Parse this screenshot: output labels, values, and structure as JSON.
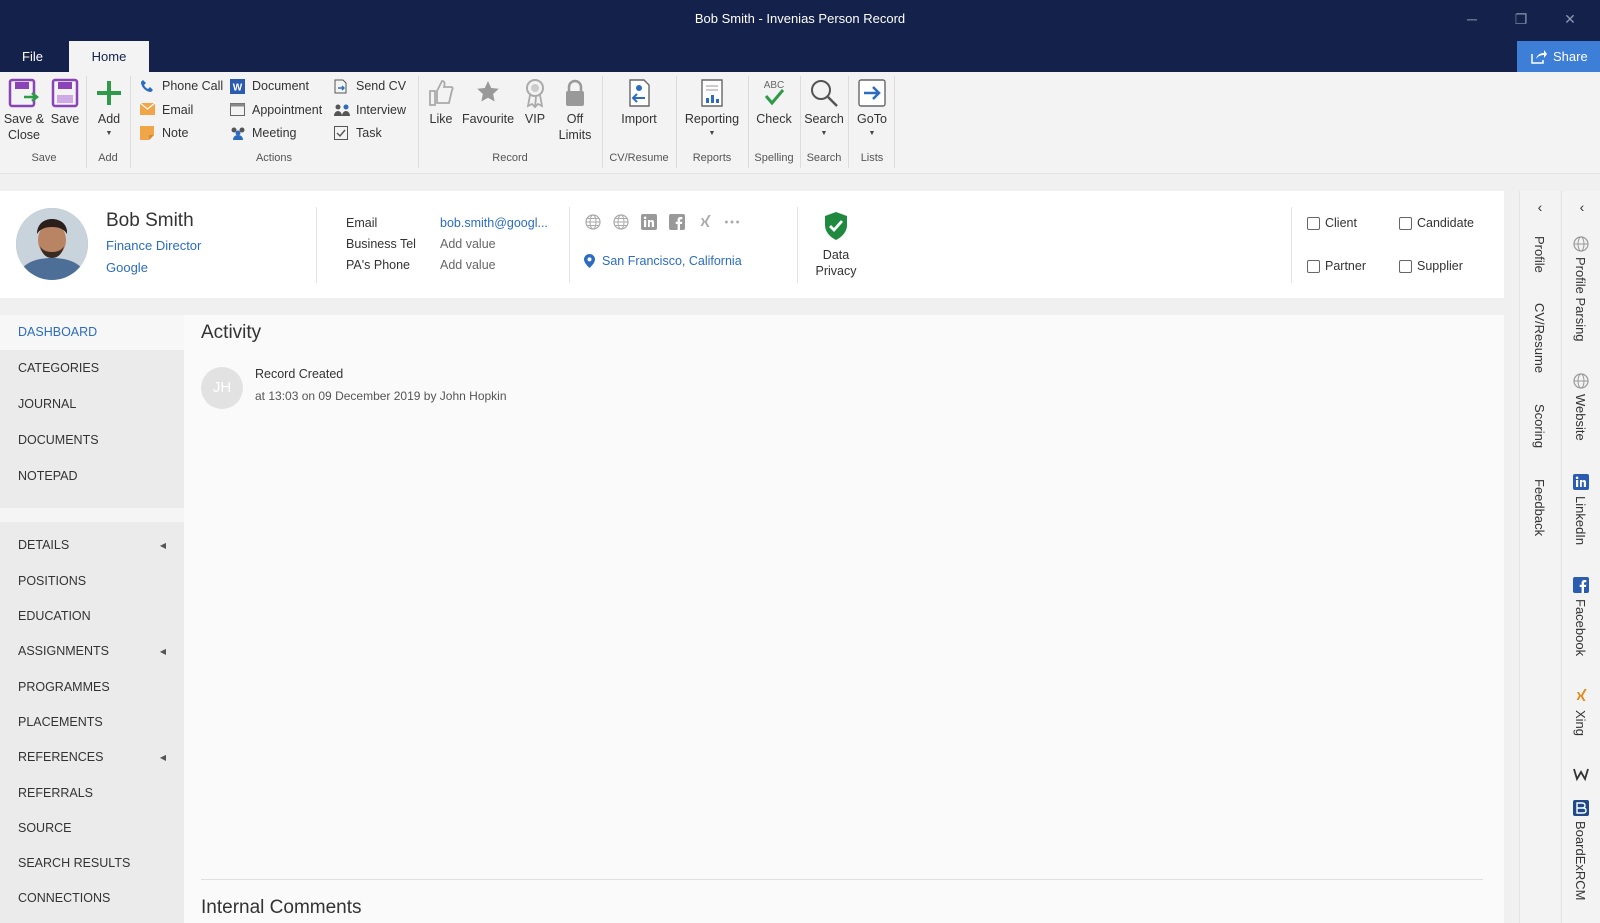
{
  "window": {
    "title": "Bob Smith - Invenias Person Record",
    "tabs": {
      "file": "File",
      "home": "Home"
    },
    "share": "Share",
    "controls": {
      "minimize": "─",
      "restore": "❐",
      "close": "✕"
    }
  },
  "ribbon": {
    "save_close": [
      "Save &",
      "Close"
    ],
    "save": "Save",
    "add": "Add",
    "actions": {
      "phone_call": "Phone Call",
      "email": "Email",
      "note": "Note",
      "document": "Document",
      "appointment": "Appointment",
      "meeting": "Meeting",
      "send_cv": "Send CV",
      "interview": "Interview",
      "task": "Task"
    },
    "record": {
      "like": "Like",
      "favourite": "Favourite",
      "vip": "VIP",
      "off_limits": [
        "Off",
        "Limits"
      ]
    },
    "import": "Import",
    "reporting": "Reporting",
    "check": "Check",
    "check_sub": "ABC",
    "search": "Search",
    "goto": "GoTo",
    "groups": {
      "save": "Save",
      "add": "Add",
      "actions": "Actions",
      "record": "Record",
      "cv_resume": "CV/Resume",
      "reports": "Reports",
      "spelling": "Spelling",
      "search": "Search",
      "lists": "Lists"
    }
  },
  "person": {
    "name": "Bob Smith",
    "job_title": "Finance Director",
    "company": "Google",
    "fields": [
      {
        "label": "Email",
        "value": "bob.smith@googl..."
      },
      {
        "label": "Business Tel",
        "value": "Add value"
      },
      {
        "label": "PA's Phone",
        "value": "Add value"
      }
    ],
    "location": "San Francisco, California",
    "data_privacy": [
      "Data",
      "Privacy"
    ],
    "types": {
      "client": "Client",
      "candidate": "Candidate",
      "partner": "Partner",
      "supplier": "Supplier"
    }
  },
  "nav": {
    "items": [
      "DASHBOARD",
      "CATEGORIES",
      "JOURNAL",
      "DOCUMENTS",
      "NOTEPAD",
      "DETAILS",
      "POSITIONS",
      "EDUCATION",
      "ASSIGNMENTS",
      "PROGRAMMES",
      "PLACEMENTS",
      "REFERENCES",
      "REFERRALS",
      "SOURCE",
      "SEARCH RESULTS",
      "CONNECTIONS"
    ]
  },
  "activity": {
    "title": "Activity",
    "items": [
      {
        "initials": "JH",
        "title": "Record Created",
        "detail": "at 13:03 on 09 December 2019 by John Hopkin"
      }
    ]
  },
  "comments": {
    "title": "Internal Comments"
  },
  "right_panel_1": {
    "tabs": [
      "Profile",
      "CV/Resume",
      "Scoring",
      "Feedback"
    ]
  },
  "right_panel_2": {
    "tabs": [
      "Profile Parsing",
      "Website",
      "LinkedIn",
      "Facebook",
      "Xing",
      "BoardExRCM"
    ]
  },
  "colors": {
    "titlebar": "#14214a",
    "accent": "#2b6cbf",
    "share": "#3d7fd6"
  }
}
